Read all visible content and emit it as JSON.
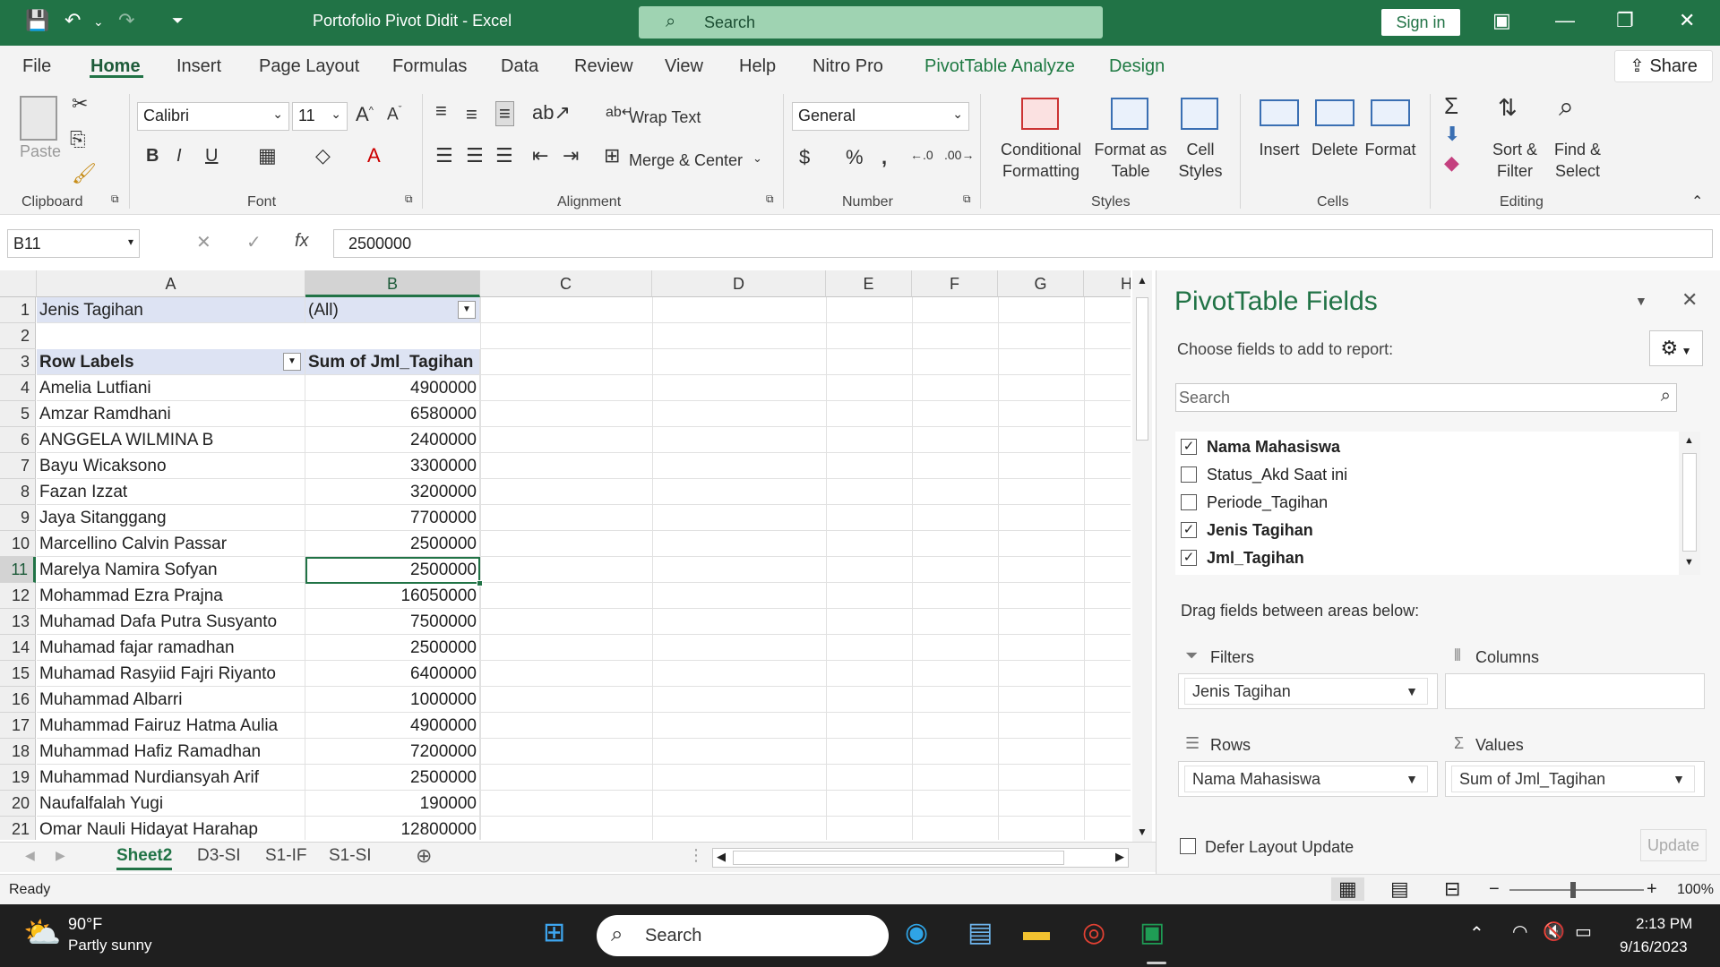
{
  "titlebar": {
    "file_title": "Portofolio Pivot Didit  -  Excel",
    "search_label": "Search",
    "signin_label": "Sign in"
  },
  "tabs": [
    "File",
    "Home",
    "Insert",
    "Page Layout",
    "Formulas",
    "Data",
    "Review",
    "View",
    "Help",
    "Nitro Pro",
    "PivotTable Analyze",
    "Design"
  ],
  "share_label": "Share",
  "ribbon": {
    "clipboard": {
      "paste": "Paste",
      "group": "Clipboard"
    },
    "font": {
      "name": "Calibri",
      "size": "11",
      "group": "Font"
    },
    "alignment": {
      "wrap": "Wrap Text",
      "merge": "Merge & Center",
      "group": "Alignment"
    },
    "number": {
      "format": "General",
      "group": "Number"
    },
    "styles": {
      "conditional_1": "Conditional",
      "conditional_2": "Formatting",
      "format_as_1": "Format as",
      "format_as_2": "Table",
      "cell_1": "Cell",
      "cell_2": "Styles",
      "group": "Styles"
    },
    "cells": {
      "insert": "Insert",
      "delete": "Delete",
      "format": "Format",
      "group": "Cells"
    },
    "editing": {
      "sort_1": "Sort &",
      "sort_2": "Filter",
      "find_1": "Find &",
      "find_2": "Select",
      "group": "Editing"
    }
  },
  "formula_bar": {
    "name_box": "B11",
    "value": "2500000"
  },
  "columns": [
    "A",
    "B",
    "C",
    "D",
    "E",
    "F",
    "G",
    "H"
  ],
  "rows": [
    "1",
    "2",
    "3",
    "4",
    "5",
    "6",
    "7",
    "8",
    "9",
    "10",
    "11",
    "12",
    "13",
    "14",
    "15",
    "16",
    "17",
    "18",
    "19",
    "20",
    "21"
  ],
  "pivot_table": {
    "filter_label": "Jenis Tagihan",
    "filter_value": "(All)",
    "row_labels_header": "Row Labels",
    "values_header": "Sum of Jml_Tagihan",
    "entries": [
      {
        "name": "Amelia Lutfiani",
        "value": "4900000"
      },
      {
        "name": "Amzar Ramdhani",
        "value": "6580000"
      },
      {
        "name": "ANGGELA WILMINA B",
        "value": "2400000"
      },
      {
        "name": "Bayu Wicaksono",
        "value": "3300000"
      },
      {
        "name": "Fazan Izzat",
        "value": "3200000"
      },
      {
        "name": "Jaya Sitanggang",
        "value": "7700000"
      },
      {
        "name": "Marcellino Calvin Passar",
        "value": "2500000"
      },
      {
        "name": "Marelya Namira Sofyan",
        "value": "2500000"
      },
      {
        "name": "Mohammad Ezra Prajna",
        "value": "16050000"
      },
      {
        "name": "Muhamad Dafa Putra Susyanto",
        "value": "7500000"
      },
      {
        "name": "Muhamad fajar ramadhan",
        "value": "2500000"
      },
      {
        "name": "Muhamad Rasyiid Fajri Riyanto",
        "value": "6400000"
      },
      {
        "name": "Muhammad Albarri",
        "value": "1000000"
      },
      {
        "name": "Muhammad Fairuz Hatma Aulia",
        "value": "4900000"
      },
      {
        "name": "Muhammad Hafiz Ramadhan",
        "value": "7200000"
      },
      {
        "name": "Muhammad Nurdiansyah Arif",
        "value": "2500000"
      },
      {
        "name": "Naufalfalah Yugi",
        "value": "190000"
      },
      {
        "name": "Omar Nauli Hidayat Harahap",
        "value": "12800000"
      }
    ]
  },
  "sheets": [
    "Sheet2",
    "D3-SI",
    "S1-IF",
    "S1-SI"
  ],
  "status": {
    "ready": "Ready",
    "zoom": "100%"
  },
  "pivot_panel": {
    "title": "PivotTable Fields",
    "subtitle": "Choose fields to add to report:",
    "search_placeholder": "Search",
    "fields": [
      {
        "label": "Nama Mahasiswa",
        "checked": true
      },
      {
        "label": "Status_Akd Saat ini",
        "checked": false
      },
      {
        "label": "Periode_Tagihan",
        "checked": false
      },
      {
        "label": "Jenis Tagihan",
        "checked": true
      },
      {
        "label": "Jml_Tagihan",
        "checked": true
      }
    ],
    "drag_label": "Drag fields between areas below:",
    "filters_label": "Filters",
    "columns_label": "Columns",
    "rows_label": "Rows",
    "values_label": "Values",
    "filters_item": "Jenis Tagihan",
    "rows_item": "Nama Mahasiswa",
    "values_item": "Sum of Jml_Tagihan",
    "defer_label": "Defer Layout Update",
    "update_label": "Update"
  },
  "taskbar": {
    "weather_temp": "90°F",
    "weather_desc": "Partly sunny",
    "search_label": "Search",
    "time": "2:13 PM",
    "date": "9/16/2023"
  },
  "colors": {
    "excel_green": "#217346",
    "pivot_header_blue": "#dde3f3"
  }
}
